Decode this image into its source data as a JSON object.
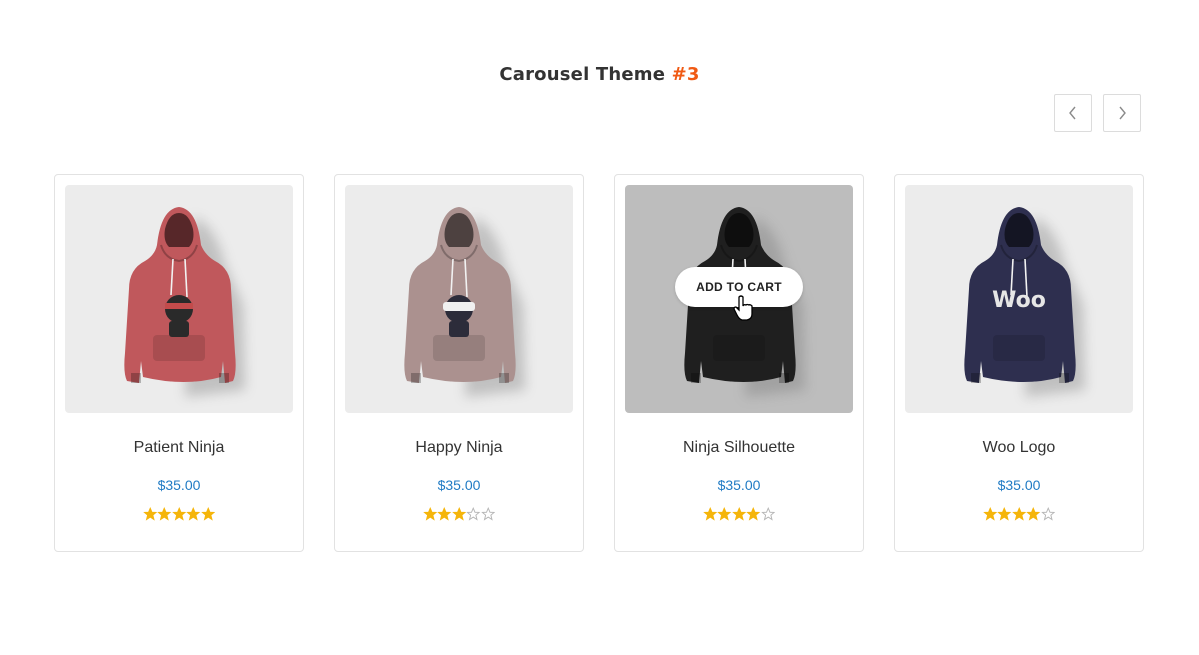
{
  "section": {
    "title": "Carousel Theme",
    "title_accent": "#3",
    "accent_color": "#f05a14"
  },
  "navigation": {
    "prev_icon": "chevron-left-icon",
    "next_icon": "chevron-right-icon"
  },
  "products": [
    {
      "name": "Patient Ninja",
      "price": "$35.00",
      "rating": 5,
      "hoodie_color": "#c0585c",
      "print": "ninja-red"
    },
    {
      "name": "Happy Ninja",
      "price": "$35.00",
      "rating": 3,
      "hoodie_color": "#ab918f",
      "print": "ninja-happy"
    },
    {
      "name": "Ninja Silhouette",
      "price": "$35.00",
      "rating": 4,
      "hoodie_color": "#1f1f1f",
      "print": "none",
      "hovered": true,
      "add_to_cart": "ADD TO CART"
    },
    {
      "name": "Woo Logo",
      "price": "$35.00",
      "rating": 4,
      "hoodie_color": "#2e2f4f",
      "print": "woo"
    }
  ],
  "colors": {
    "price": "#1f7ac4",
    "star_filled": "#f5b50a",
    "star_empty": "#b5b5b5"
  }
}
